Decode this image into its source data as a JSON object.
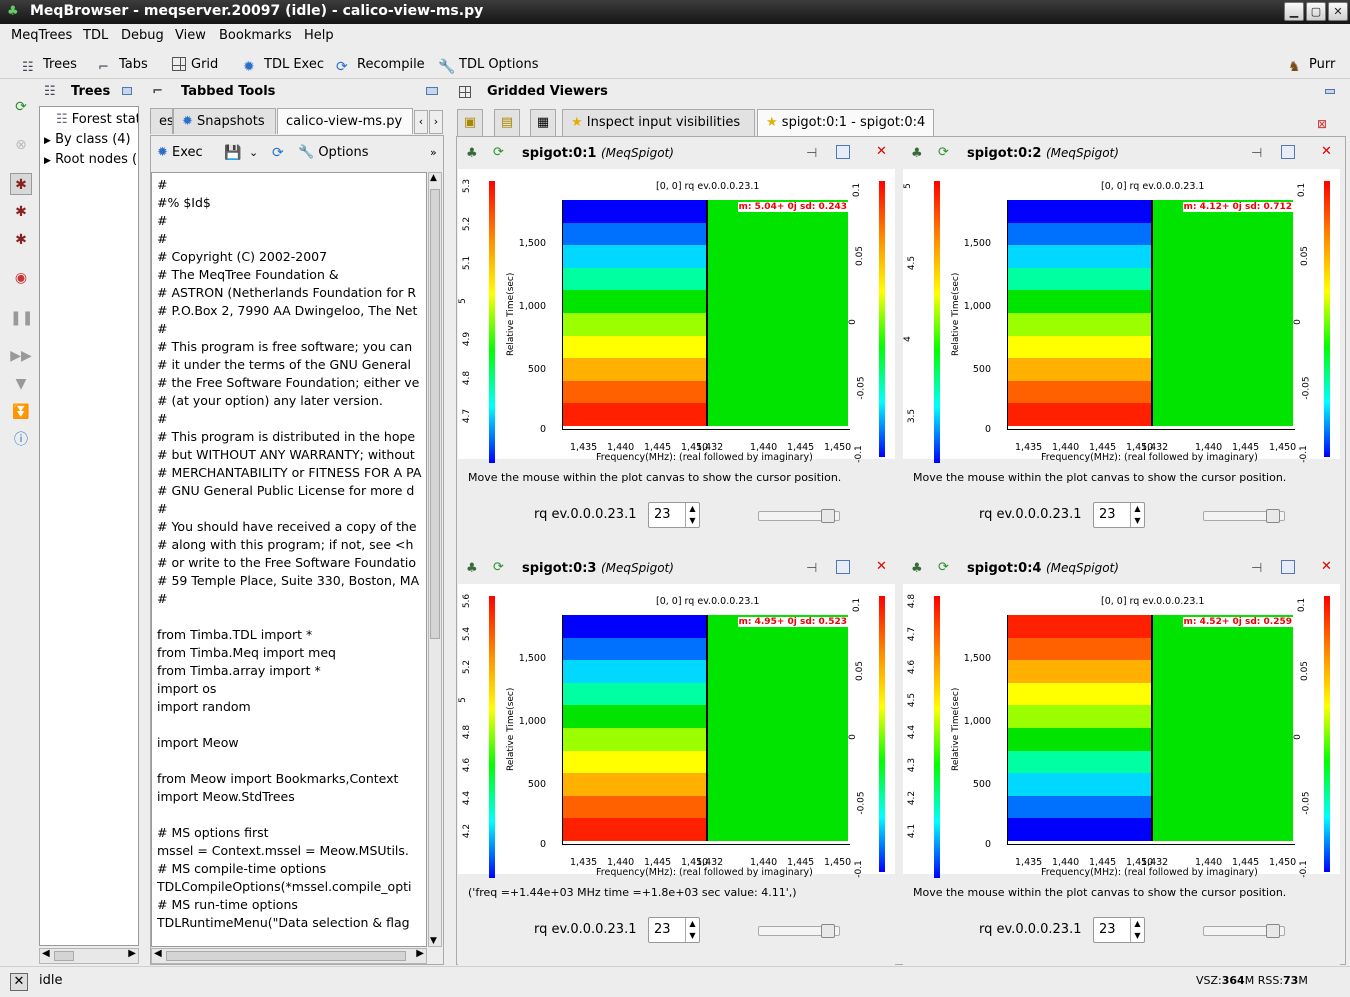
{
  "window": {
    "title": "MeqBrowser - meqserver.20097 (idle) - calico-view-ms.py"
  },
  "menu": [
    "MeqTrees",
    "TDL",
    "Debug",
    "View",
    "Bookmarks",
    "Help"
  ],
  "toolbar": {
    "trees": "Trees",
    "tabs": "Tabs",
    "grid": "Grid",
    "tdl_exec": "TDL Exec",
    "recompile": "Recompile",
    "tdl_options": "TDL Options",
    "purr": "Purr"
  },
  "trees_pane": {
    "title": "Trees",
    "items": [
      "Forest state",
      "By class (4)",
      "Root nodes ("
    ]
  },
  "tabbed_pane": {
    "title": "Tabbed Tools",
    "tabs": [
      "es",
      "Snapshots",
      "calico-view-ms.py"
    ],
    "toolbar": {
      "exec": "Exec",
      "options": "Options"
    },
    "code_lines": [
      "#",
      "#% $Id$",
      "#",
      "#",
      "# Copyright (C) 2002-2007",
      "# The MeqTree Foundation &",
      "# ASTRON (Netherlands Foundation for R",
      "# P.O.Box 2, 7990 AA Dwingeloo, The Net",
      "#",
      "# This program is free software; you can",
      "# it under the terms of the GNU General",
      "# the Free Software Foundation; either ve",
      "# (at your option) any later version.",
      "#",
      "# This program is distributed in the hope",
      "# but WITHOUT ANY WARRANTY; without",
      "# MERCHANTABILITY or FITNESS FOR A PA",
      "# GNU General Public License for more d",
      "#",
      "# You should have received a copy of the",
      "# along with this program; if not, see <h",
      "# or write to the Free Software Foundatio",
      "# 59 Temple Place, Suite 330, Boston, MA",
      "#",
      "",
      "from Timba.TDL import *",
      "from Timba.Meq import meq",
      "from Timba.array import *",
      "import os",
      "import random",
      "",
      "import Meow",
      "",
      "from Meow import Bookmarks,Context",
      "import Meow.StdTrees",
      "",
      "# MS options first",
      "mssel = Context.mssel = Meow.MSUtils.",
      "# MS compile-time options",
      "TDLCompileOptions(*mssel.compile_opti",
      "# MS run-time options",
      "TDLRuntimeMenu(\"Data selection & flag"
    ]
  },
  "grid_pane": {
    "title": "Gridded Viewers",
    "tabs": [
      "Inspect input visibilities",
      "spigot:0:1 - spigot:0:4"
    ]
  },
  "panels": [
    {
      "name": "spigot:0:1",
      "cls": "(MeqSpigot)",
      "plot_title": "[0, 0] rq ev.0.0.0.23.1",
      "stat": "m: 5.04+ 0j sd: 0.243",
      "ytick_left": [
        "5.3",
        "5.2",
        "5.1",
        "5",
        "4.9",
        "4.8",
        "4.7"
      ],
      "hint": "Move the mouse within the plot canvas to show the cursor position.",
      "rq": "rq ev.0.0.0.23.1",
      "spin": "23",
      "order": "up"
    },
    {
      "name": "spigot:0:2",
      "cls": "(MeqSpigot)",
      "plot_title": "[0, 0] rq ev.0.0.0.23.1",
      "stat": "m: 4.12+ 0j sd: 0.712",
      "ytick_left": [
        "5",
        "4.5",
        "4",
        "3.5"
      ],
      "hint": "Move the mouse within the plot canvas to show the cursor position.",
      "rq": "rq ev.0.0.0.23.1",
      "spin": "23",
      "order": "up"
    },
    {
      "name": "spigot:0:3",
      "cls": "(MeqSpigot)",
      "plot_title": "[0, 0] rq ev.0.0.0.23.1",
      "stat": "m: 4.95+ 0j sd: 0.523",
      "ytick_left": [
        "5.6",
        "5.4",
        "5.2",
        "5",
        "4.8",
        "4.6",
        "4.4",
        "4.2"
      ],
      "hint": "('freq  =+1.44e+03 MHz  time  =+1.8e+03 sec value: 4.11',)",
      "rq": "rq ev.0.0.0.23.1",
      "spin": "23",
      "order": "up"
    },
    {
      "name": "spigot:0:4",
      "cls": "(MeqSpigot)",
      "plot_title": "[0, 0] rq ev.0.0.0.23.1",
      "stat": "m: 4.52+ 0j sd: 0.259",
      "ytick_left": [
        "4.8",
        "4.7",
        "4.6",
        "4.5",
        "4.4",
        "4.3",
        "4.2",
        "4.1"
      ],
      "hint": "Move the mouse within the plot canvas to show the cursor position.",
      "rq": "rq ev.0.0.0.23.1",
      "spin": "23",
      "order": "down"
    }
  ],
  "axes": {
    "ylabel": "Relative Time(sec)",
    "xlabel": "Frequency(MHz): (real followed by imaginary)",
    "yticks": [
      "1,500",
      "1,000",
      "500",
      "0"
    ],
    "xticks_left": [
      "1,435",
      "1,440",
      "1,445",
      "1,450"
    ],
    "xticks_right": [
      "1,432",
      "1,440",
      "1,445",
      "1,450"
    ],
    "xmid": "1,432",
    "right_ticks": [
      "0.1",
      "0.05",
      "0",
      "-0.05",
      "-0.1"
    ]
  },
  "status": {
    "text": "idle",
    "vsz_label": "VSZ:",
    "vsz": "364",
    "rss_label": "M RSS:",
    "rss": "73",
    "rss_unit": "M"
  }
}
